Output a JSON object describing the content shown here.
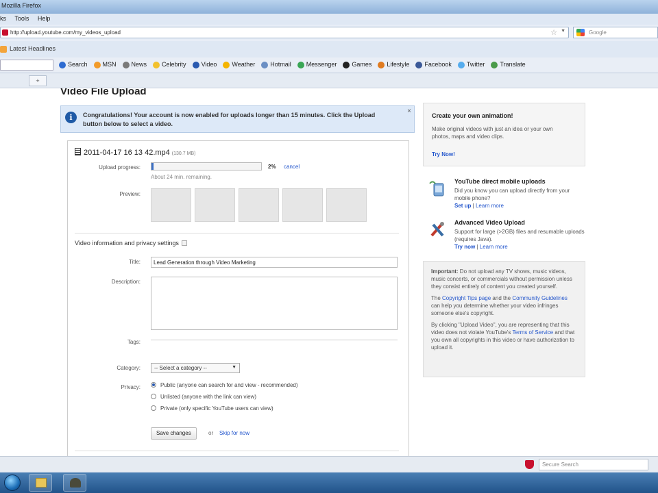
{
  "window": {
    "title": "Mozilla Firefox"
  },
  "menu": {
    "items": [
      "ks",
      "Tools",
      "Help"
    ]
  },
  "nav": {
    "url": "http://upload.youtube.com/my_videos_upload",
    "search_placeholder": "Google"
  },
  "bookmarks": {
    "item": "Latest Headlines"
  },
  "toolbar": {
    "items": [
      {
        "label": "Search",
        "icon": "search-icon",
        "color": "#2d6bd1"
      },
      {
        "label": "MSN",
        "icon": "msn-butterfly-icon",
        "color": "#f29b2a"
      },
      {
        "label": "News",
        "icon": "news-icon",
        "color": "#7a7a7a"
      },
      {
        "label": "Celebrity",
        "icon": "star-icon",
        "color": "#f2c12e"
      },
      {
        "label": "Video",
        "icon": "video-icon",
        "color": "#2a5ab0"
      },
      {
        "label": "Weather",
        "icon": "weather-icon",
        "color": "#f4b400"
      },
      {
        "label": "Hotmail",
        "icon": "mail-icon",
        "color": "#6b8fc4"
      },
      {
        "label": "Messenger",
        "icon": "messenger-icon",
        "color": "#3aa655"
      },
      {
        "label": "Games",
        "icon": "games-icon",
        "color": "#222222"
      },
      {
        "label": "Lifestyle",
        "icon": "lifestyle-icon",
        "color": "#e07b20"
      },
      {
        "label": "Facebook",
        "icon": "facebook-icon",
        "color": "#3b5998"
      },
      {
        "label": "Twitter",
        "icon": "twitter-icon",
        "color": "#55acee"
      },
      {
        "label": "Translate",
        "icon": "translate-icon",
        "color": "#4a9b4a"
      }
    ]
  },
  "tabstrip": {
    "button": "+"
  },
  "page": {
    "title": "Video File Upload"
  },
  "notice": {
    "text": "Congratulations! Your account is now enabled for uploads longer than 15 minutes. Click the Upload button below to select a video.",
    "close": "×"
  },
  "upload": {
    "filename": "2011-04-17 16 13 42.mp4",
    "filesize": "(130.7 MB)",
    "progress_label": "Upload progress:",
    "progress_percent": "2%",
    "progress_fraction": 0.02,
    "cancel": "cancel",
    "remaining": "About 24 min. remaining.",
    "preview_label": "Preview:",
    "section_title": "Video information and privacy settings",
    "title_label": "Title:",
    "title_value": "Lead Generation through Video Marketing",
    "description_label": "Description:",
    "description_value": "",
    "tags_label": "Tags:",
    "category_label": "Category:",
    "category_value": "-- Select a category --",
    "privacy_label": "Privacy:",
    "privacy_options": [
      {
        "label": "Public (anyone can search for and view - recommended)",
        "selected": true
      },
      {
        "label": "Unlisted (anyone with the link can view)",
        "selected": false
      },
      {
        "label": "Private (only specific YouTube users can view)",
        "selected": false
      }
    ],
    "save": "Save changes",
    "or": "or",
    "skip": "Skip for now"
  },
  "sidebar": {
    "promo": {
      "title": "Create your own animation!",
      "desc": "Make original videos with just an idea or your own photos, maps and video clips.",
      "link": "Try Now!"
    },
    "mobile": {
      "title": "YouTube direct mobile uploads",
      "desc": "Did you know you can upload directly from your mobile phone?",
      "link1": "Set up",
      "link2": "Learn more"
    },
    "advanced": {
      "title": "Advanced Video Upload",
      "desc": "Support for large (>2GB) files and resumable uploads (requires Java).",
      "link1": "Try now",
      "link2": "Learn more"
    },
    "important": {
      "p1_bold": "Important:",
      "p1": "Do not upload any TV shows, music videos, music concerts, or commercials without permission unless they consist entirely of content you created yourself.",
      "p2_pre": "The",
      "p2_link1": "Copyright Tips page",
      "p2_mid": "and the",
      "p2_link2": "Community Guidelines",
      "p2_post": "can help you determine whether your video infringes someone else's copyright.",
      "p3_pre": "By clicking \"Upload Video\", you are representing that this video does not violate YouTube's",
      "p3_link": "Terms of Service",
      "p3_post": "and that you own all copyrights in this video or have authorization to upload it."
    }
  },
  "statusbar": {
    "secure_search": "Secure Search"
  }
}
